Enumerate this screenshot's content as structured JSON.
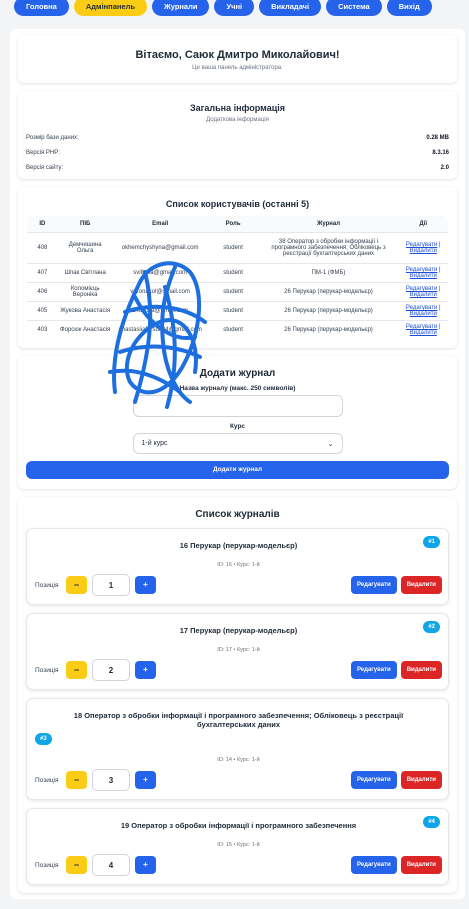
{
  "nav": [
    "Головна",
    "Адмінпанель",
    "Журнали",
    "Учні",
    "Викладачі",
    "Система",
    "Вихід"
  ],
  "welcome": {
    "title": "Вітаємо, Саюк Дмитро Миколайович!",
    "subtitle": "Це ваша панель адміністратора."
  },
  "info": {
    "title": "Загальна інформація",
    "subtitle": "Додаткова інформація",
    "rows": [
      {
        "label": "Розмір бази даних:",
        "value": "0.28 MB"
      },
      {
        "label": "Версія PHP:",
        "value": "8.3.16"
      },
      {
        "label": "Версія сайту:",
        "value": "2.0"
      }
    ]
  },
  "users": {
    "title": "Список користувачів (останні 5)",
    "headers": [
      "ID",
      "ПІБ",
      "Email",
      "Роль",
      "Журнал",
      "Дії"
    ],
    "edit_label": "Редагувати",
    "delete_label": "Видалити",
    "rows": [
      {
        "id": "408",
        "name": "Демчишина Ольга",
        "email": "okhemchyshyna@gmail.com",
        "role": "student",
        "journal": "38 Оператор з обробки інформації і програмного забезпечення; Обліковець з реєстрації бухгалтерських даних"
      },
      {
        "id": "407",
        "name": "Шпак Світлана",
        "email": "svitlana@gmail.com",
        "role": "student",
        "journal": "ПМ-1 (ФМБ)"
      },
      {
        "id": "406",
        "name": "Коломієць Вероніка",
        "email": "veronakol@gmail.com",
        "role": "student",
        "journal": "26 Перукар (перукар-модельєр)"
      },
      {
        "id": "405",
        "name": "Жукова Анастасія",
        "email": "zhukova@gmail.com",
        "role": "student",
        "journal": "26 Перукар (перукар-модельєр)"
      },
      {
        "id": "403",
        "name": "Форсюк Анастасія",
        "email": "anastasiiaforsuk04@gmail.com",
        "role": "student",
        "journal": "26 Перукар (перукар-модельєр)"
      }
    ]
  },
  "add_journal": {
    "title": "Додати журнал",
    "name_label": "Назва журналу (макс. 250 символів)",
    "course_label": "Курс",
    "course_value": "1-й курс",
    "submit_label": "Додати журнал"
  },
  "journals": {
    "title": "Список журналів",
    "position_label": "Позиція",
    "edit_label": "Редагувати",
    "delete_label": "Видалити",
    "items": [
      {
        "name": "16 Перукар (перукар-модельєр)",
        "meta": "ID: 16 • Курс: 1-й",
        "badge": "#1",
        "position": "1"
      },
      {
        "name": "17 Перукар (перукар-модельєр)",
        "meta": "ID: 17 • Курс: 1-й",
        "badge": "#2",
        "position": "2"
      },
      {
        "name": "18 Оператор з обробки інформації і програмного забезпечення; Обліковець з реєстрації бухгалтерських даних",
        "meta": "ID: 14 • Курс: 1-й",
        "badge": "#3",
        "position": "3"
      },
      {
        "name": "19 Оператор з обробки інформації і програмного забезпечення",
        "meta": "ID: 15 • Курс: 1-й",
        "badge": "#4",
        "position": "4"
      }
    ]
  }
}
